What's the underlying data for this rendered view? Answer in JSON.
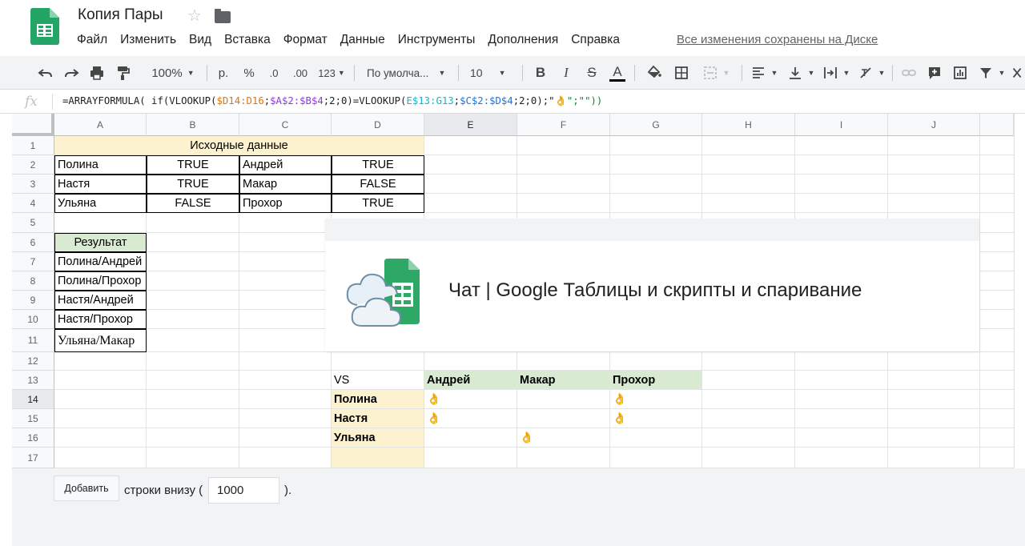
{
  "header": {
    "title": "Копия Пары",
    "menu": [
      "Файл",
      "Изменить",
      "Вид",
      "Вставка",
      "Формат",
      "Данные",
      "Инструменты",
      "Дополнения",
      "Справка"
    ],
    "save_status": "Все изменения сохранены на Диске"
  },
  "toolbar": {
    "zoom": "100%",
    "currency": "р.",
    "percent": "%",
    "dec_decrease": ".0",
    "dec_increase": ".00",
    "format_more": "123",
    "font": "По умолча...",
    "font_size": "10",
    "bold": "B",
    "italic": "I",
    "strike": "S",
    "text_color": "A"
  },
  "formula": {
    "fx": "fx",
    "parts": [
      "=ARRAYFORMULA( if(VLOOKUP(",
      "$D14:D16",
      ";",
      "$A$2:$B$4",
      ";2;0)=VLOOKUP(",
      "E$13:G13",
      ";",
      "$C$2:$D$4",
      ";2;0);\"",
      "👌",
      "\";\"\"))"
    ]
  },
  "columns": [
    "A",
    "B",
    "C",
    "D",
    "E",
    "F",
    "G",
    "H",
    "I",
    "J"
  ],
  "rows": [
    "1",
    "2",
    "3",
    "4",
    "5",
    "6",
    "7",
    "8",
    "9",
    "10",
    "11",
    "12",
    "13",
    "14",
    "15",
    "16",
    "17"
  ],
  "sheet": {
    "source_header": "Исходные данные",
    "source": [
      [
        "Полина",
        "TRUE",
        "Андрей",
        "TRUE"
      ],
      [
        "Настя",
        "TRUE",
        "Макар",
        "FALSE"
      ],
      [
        "Ульяна",
        "FALSE",
        "Прохор",
        "TRUE"
      ]
    ],
    "result_header": "Результат",
    "results": [
      "Полина/Андрей",
      "Полина/Прохор",
      "Настя/Андрей",
      "Настя/Прохор",
      "Ульяна/Макар"
    ],
    "vs_label": "VS",
    "vs_cols": [
      "Андрей",
      "Макар",
      "Прохор"
    ],
    "vs_rows": [
      "Полина",
      "Настя",
      "Ульяна"
    ],
    "vs_values": [
      [
        "👌",
        "",
        "👌"
      ],
      [
        "👌",
        "",
        "👌"
      ],
      [
        "",
        "👌",
        ""
      ]
    ]
  },
  "chat_card": {
    "title": "Чат | Google Таблицы и скрипты и спаривание"
  },
  "bottom": {
    "add_button": "Добавить",
    "rows_text": "строки внизу (",
    "rows_value": "1000",
    "rows_close": ")."
  },
  "colors": {
    "beige": "#fdf2cf",
    "green": "#d9ead3",
    "accent": "#1a73e8",
    "sheets_green": "#0f9d58"
  }
}
